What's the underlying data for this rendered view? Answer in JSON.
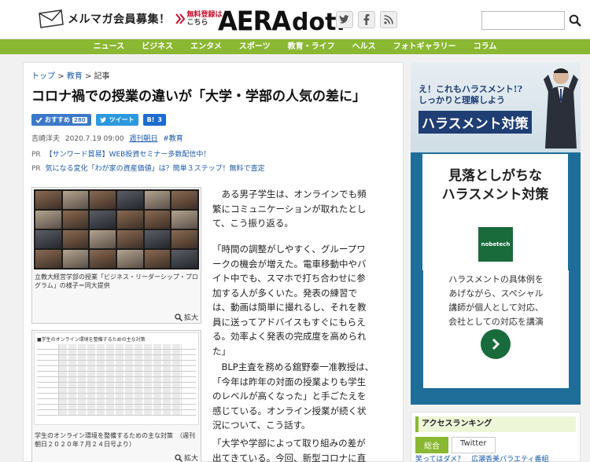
{
  "header": {
    "mailmag_label": "メルマガ会員募集！",
    "register_line1": "無料登録は",
    "register_line2": "こちら",
    "logo_main": "AERA",
    "logo_sub": "dot."
  },
  "nav": {
    "items": [
      "ニュース",
      "ビジネス",
      "エンタメ",
      "スポーツ",
      "教育・ライフ",
      "ヘルス",
      "フォトギャラリー",
      "コラム"
    ]
  },
  "article": {
    "breadcrumb": {
      "top": "トップ",
      "sep1": ">",
      "category": "教育",
      "sep2": ">",
      "current": "記事"
    },
    "title": "コロナ禍での授業の違いが「大学・学部の人気の差に」",
    "share": {
      "recommend_label": "おすすめ",
      "recommend_count": "280",
      "tweet_label": "ツイート",
      "hatena_label": "B!",
      "hatena_count": "3"
    },
    "byline": {
      "author": "吉崎洋夫",
      "date": "2020.7.19 09:00",
      "source": "週刊朝日",
      "tag": "#教育"
    },
    "pr1": {
      "prefix": "PR",
      "text": "【サンワード貿易】WEB投資セミナー多数配信中！"
    },
    "pr2": {
      "prefix": "PR",
      "text": "気になる変化「わが家の資産価値」は？簡単３ステップ！無料で査定"
    },
    "photo1": {
      "caption": "立教大経営学部の授業「ビジネス・リーダーシップ・プログラム」の様子＝同大提供",
      "zoom_label": "拡大"
    },
    "photo2": {
      "table_title": "■学生のオンライン環境を整備するための主な対策",
      "caption": "学生のオンライン環境を整備するための主な対策　（週刊朝日２０２０年７月２４日号より）",
      "zoom_label": "拡大"
    },
    "paragraphs": [
      "　ある男子学生は、オンラインでも頻繁にコミュニケーションが取れたとして、こう振り返る。",
      "「時間の調整がしやすく、グループワークの機会が増えた。電車移動中やバイト中でも、スマホで打ち合わせに参加する人が多くいた。発表の練習では、動画は簡単に撮れるし、それを教員に送ってアドバイスもすぐにもらえる。効率よく発表の完成度を高められた」",
      "　BLP主査を務める舘野泰一准教授は、「今年は昨年の対面の授業よりも学生のレベルが高くなった」と手ごたえを感じている。オンライン授業が続く状況について、こう話す。",
      "「大学や学部によって取り組みの差が出てきている。今回、新型コロナに直面し"
    ]
  },
  "ad": {
    "question_line1": "え！これもハラスメント!?",
    "question_line2": "しっかりと理解しよう",
    "headline": "ハラスメント対策",
    "card_title_line1": "見落としがちな",
    "card_title_line2": "ハラスメント対策",
    "brand": "nobetech",
    "body_line1": "ハラスメントの具体例を",
    "body_line2": "あげながら、スペシャル",
    "body_line3": "講師が個人として対応、",
    "body_line4": "会社としての対応を講演"
  },
  "ranking": {
    "title": "アクセスランキング",
    "tab_total": "総合",
    "tab_twitter": "Twitter",
    "first_item": "笑ってはダメ？　広瀬香美パラエティ番組"
  }
}
